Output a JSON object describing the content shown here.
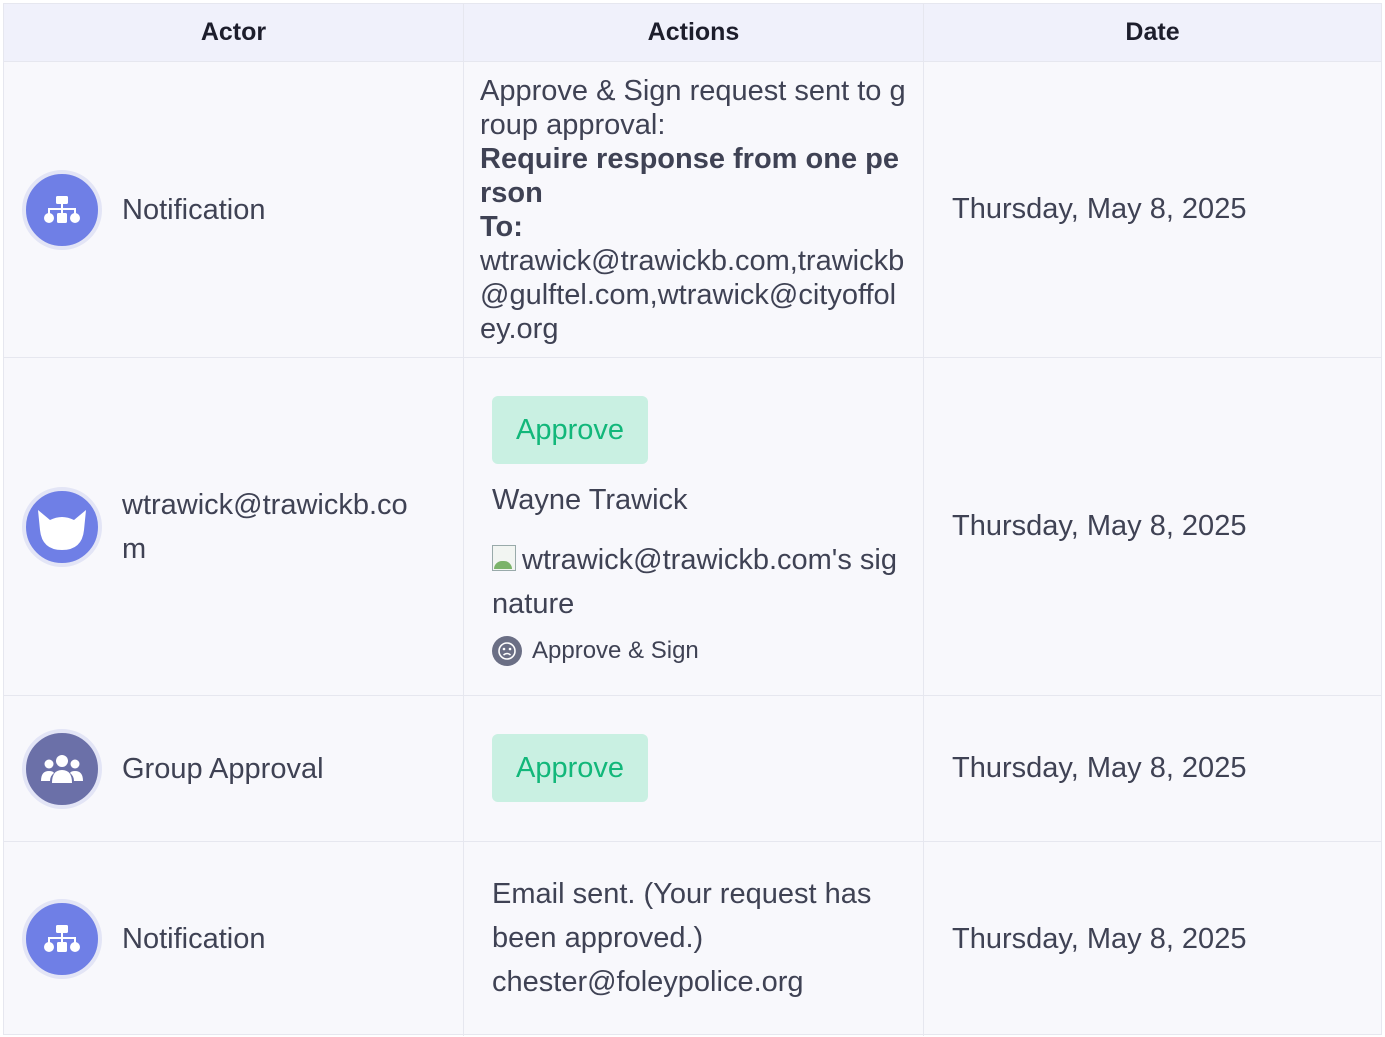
{
  "header": {
    "actor": "Actor",
    "actions": "Actions",
    "date": "Date"
  },
  "rows": [
    {
      "actor": "Notification",
      "actor_icon": "sitemap-icon",
      "actions": {
        "line1": "Approve & Sign request sent to group approval:",
        "bold1": "Require response from one person",
        "bold2": "To:",
        "recipients": "wtrawick@trawickb.com,trawickb@gulftel.com,wtrawick@cityoffoley.org"
      },
      "date": "Thursday, May 8, 2025"
    },
    {
      "actor": "wtrawick@trawickb.com",
      "actor_icon": "cat-icon",
      "actions": {
        "button": "Approve",
        "person": "Wayne Trawick",
        "signature_alt": "wtrawick@trawickb.com's signature",
        "method": "Approve & Sign"
      },
      "date": "Thursday, May 8, 2025"
    },
    {
      "actor": "Group Approval",
      "actor_icon": "users-icon",
      "actions": {
        "button": "Approve"
      },
      "date": "Thursday, May 8, 2025"
    },
    {
      "actor": "Notification",
      "actor_icon": "sitemap-icon",
      "actions": {
        "line1": "Email sent. (Your request has been approved.)",
        "line2": "chester@foleypolice.org"
      },
      "date": "Thursday, May 8, 2025"
    }
  ],
  "colors": {
    "accent": "#6f7fe6",
    "group_avatar": "#6b70a8",
    "approve_bg": "#c9f0e2",
    "approve_text": "#12b77a"
  }
}
